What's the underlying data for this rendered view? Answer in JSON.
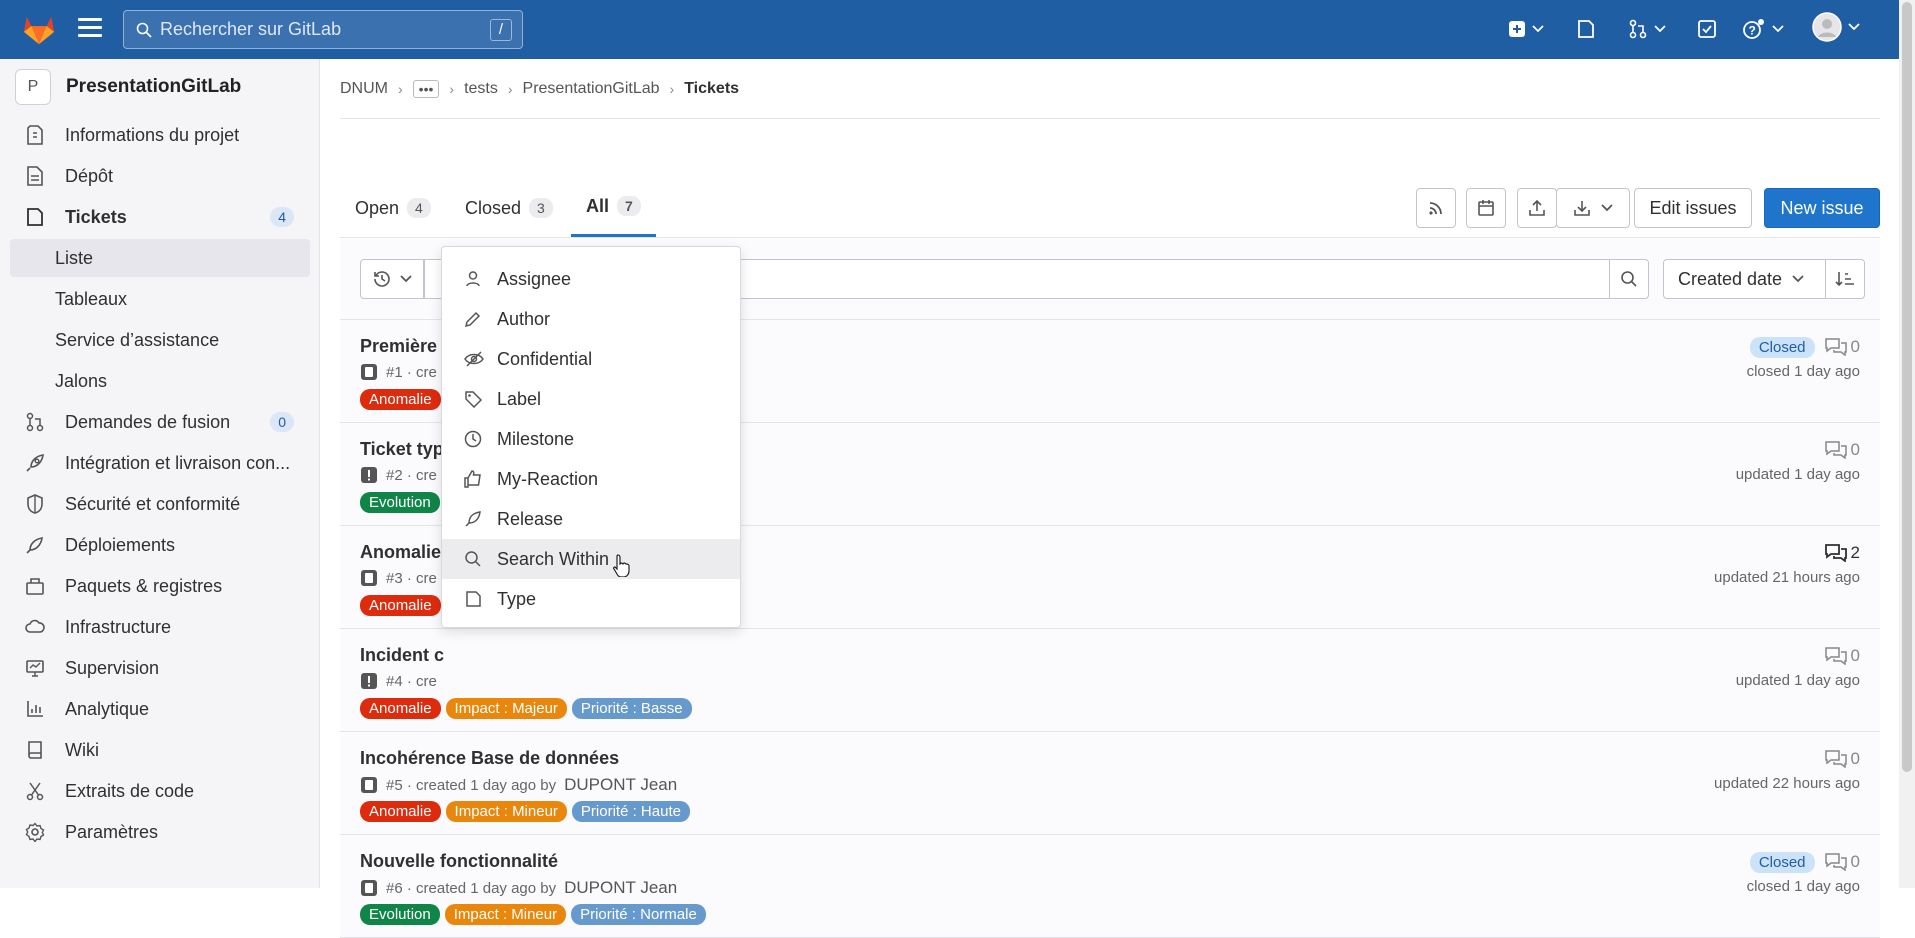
{
  "topbar": {
    "search_placeholder": "Rechercher sur GitLab",
    "search_shortcut": "/"
  },
  "sidebar": {
    "project_initial": "P",
    "project_name": "PresentationGitLab",
    "items": [
      {
        "label": "Informations du projet"
      },
      {
        "label": "Dépôt"
      },
      {
        "label": "Tickets",
        "count": "4"
      },
      {
        "label": "Liste"
      },
      {
        "label": "Tableaux"
      },
      {
        "label": "Service d’assistance"
      },
      {
        "label": "Jalons"
      },
      {
        "label": "Demandes de fusion",
        "count": "0"
      },
      {
        "label": "Intégration et livraison con..."
      },
      {
        "label": "Sécurité et conformité"
      },
      {
        "label": "Déploiements"
      },
      {
        "label": "Paquets & registres"
      },
      {
        "label": "Infrastructure"
      },
      {
        "label": "Supervision"
      },
      {
        "label": "Analytique"
      },
      {
        "label": "Wiki"
      },
      {
        "label": "Extraits de code"
      },
      {
        "label": "Paramètres"
      }
    ]
  },
  "breadcrumb": [
    "DNUM",
    "tests",
    "PresentationGitLab",
    "Tickets"
  ],
  "tabs": [
    {
      "label": "Open",
      "count": "4"
    },
    {
      "label": "Closed",
      "count": "3"
    },
    {
      "label": "All",
      "count": "7"
    }
  ],
  "actions": {
    "edit_issues": "Edit issues",
    "new_issue": "New issue",
    "sort_label": "Created date"
  },
  "dropdown": [
    "Assignee",
    "Author",
    "Confidential",
    "Label",
    "Milestone",
    "My-Reaction",
    "Release",
    "Search Within",
    "Type"
  ],
  "issues": [
    {
      "title": "Première",
      "meta": "#1 · cre",
      "author": "",
      "labels": [
        "Anomalie"
      ],
      "status": "Closed",
      "comments": "0",
      "time": "closed 1 day ago"
    },
    {
      "title": "Ticket typ",
      "meta": "#2 · cre",
      "author": "",
      "labels": [
        "Evolution"
      ],
      "status": "",
      "comments": "0",
      "time": "updated 1 day ago"
    },
    {
      "title": "Anomalie",
      "meta": "#3 · cre",
      "author": "",
      "labels": [
        "Anomalie"
      ],
      "status": "",
      "comments": "2",
      "time": "updated 21 hours ago"
    },
    {
      "title": "Incident c",
      "meta": "#4 · cre",
      "author": "",
      "labels": [
        "Anomalie",
        "Impact : Majeur",
        "Priorité : Basse"
      ],
      "status": "",
      "comments": "0",
      "time": "updated 1 day ago"
    },
    {
      "title": "Incohérence Base de données",
      "meta": "#5 · created 1 day ago by",
      "author": "DUPONT Jean",
      "labels": [
        "Anomalie",
        "Impact : Mineur",
        "Priorité : Haute"
      ],
      "status": "",
      "comments": "0",
      "time": "updated 22 hours ago"
    },
    {
      "title": "Nouvelle fonctionnalité",
      "meta": "#6 · created 1 day ago by",
      "author": "DUPONT Jean",
      "labels": [
        "Evolution",
        "Impact : Mineur",
        "Priorité : Normale"
      ],
      "status": "Closed",
      "comments": "0",
      "time": "closed 1 day ago"
    }
  ],
  "colors": {
    "topbar": "#1f5ea3",
    "primary": "#1f75cb",
    "anomalie": "#dd2b0e",
    "evolution": "#108548",
    "impact": "#e9860c",
    "priorite": "#6699cc"
  }
}
